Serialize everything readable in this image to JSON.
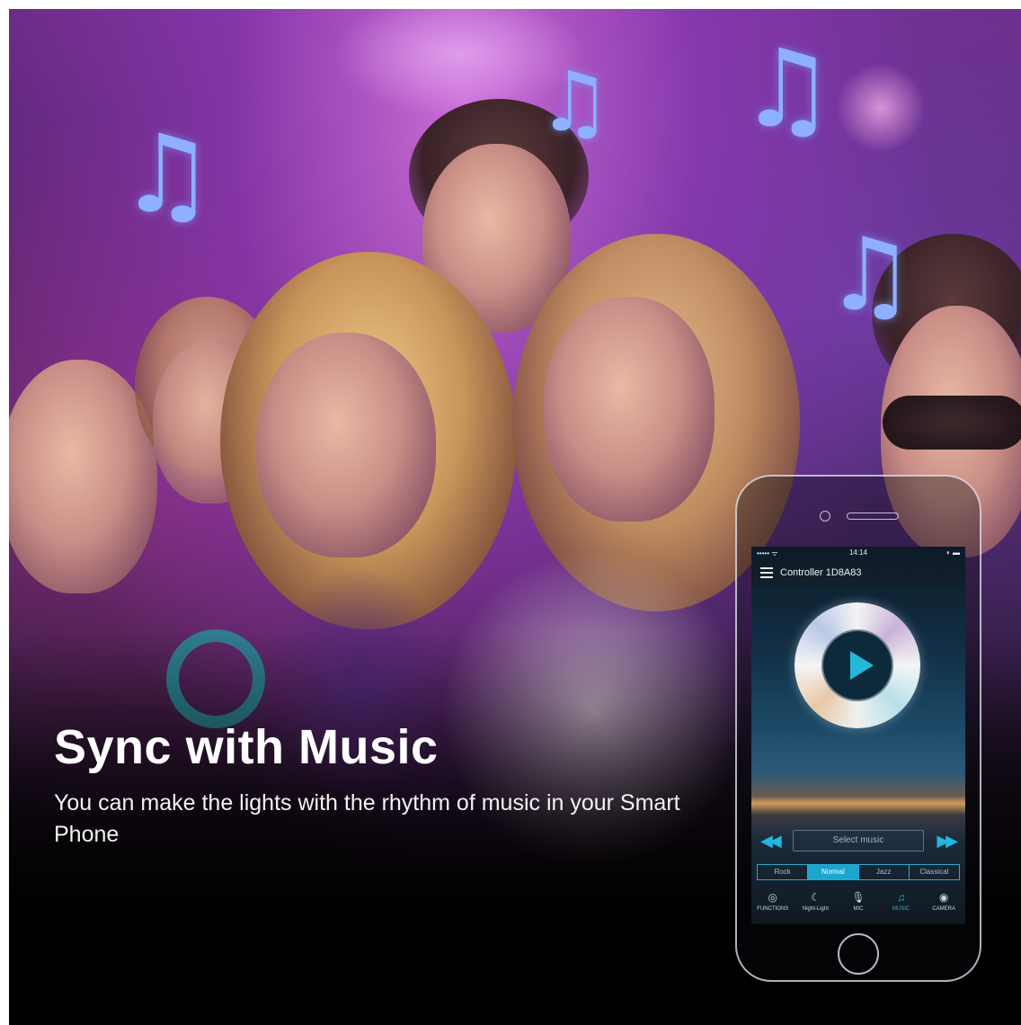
{
  "colors": {
    "accent": "#23b6df",
    "note_blue": "#8fb0ff",
    "headline": "#ffffff"
  },
  "hero": {
    "headline": "Sync with Music",
    "subtext": "You can make the lights with the rhythm of music in your Smart Phone"
  },
  "decor": {
    "notes": [
      "beamed-eighth-notes-icon",
      "beamed-eighth-notes-icon",
      "beamed-eighth-notes-icon",
      "beamed-eighth-notes-icon"
    ]
  },
  "app": {
    "status_time": "14:14",
    "status_signal": "••••• ᯤ",
    "status_battery": "◐ ▬",
    "title": "Controller 1D8A83",
    "select_music_label": "Select music",
    "genres": [
      {
        "label": "Rock",
        "active": false
      },
      {
        "label": "Normal",
        "active": true
      },
      {
        "label": "Jazz",
        "active": false
      },
      {
        "label": "Classical",
        "active": false
      }
    ],
    "tabs": [
      {
        "label": "FUNCTIONS",
        "icon": "functions-icon",
        "glyph": "◎",
        "active": false
      },
      {
        "label": "Night-Light",
        "icon": "moon-icon",
        "glyph": "☾",
        "active": false
      },
      {
        "label": "MIC",
        "icon": "microphone-icon",
        "glyph": "🎙",
        "active": false
      },
      {
        "label": "MUSIC",
        "icon": "music-note-icon",
        "glyph": "♫",
        "active": true
      },
      {
        "label": "CAMERA",
        "icon": "camera-icon",
        "glyph": "◉",
        "active": false
      }
    ]
  }
}
